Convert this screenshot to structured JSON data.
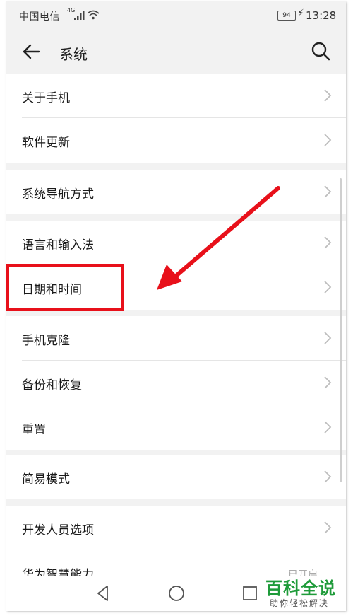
{
  "status_bar": {
    "carrier": "中国电信",
    "network": "4G",
    "battery": "94",
    "time": "13:28"
  },
  "header": {
    "title": "系统",
    "back_icon": "back-arrow-icon",
    "search_icon": "search-icon"
  },
  "groups": [
    {
      "items": [
        {
          "label": "关于手机"
        },
        {
          "label": "软件更新"
        }
      ]
    },
    {
      "items": [
        {
          "label": "系统导航方式"
        }
      ]
    },
    {
      "items": [
        {
          "label": "语言和输入法"
        },
        {
          "label": "日期和时间"
        }
      ]
    },
    {
      "items": [
        {
          "label": "手机克隆"
        },
        {
          "label": "备份和恢复"
        },
        {
          "label": "重置"
        }
      ]
    },
    {
      "items": [
        {
          "label": "简易模式"
        }
      ]
    },
    {
      "items": [
        {
          "label": "开发人员选项"
        },
        {
          "label": "华为智慧能力",
          "extra": "已开启"
        }
      ]
    }
  ],
  "annotation": {
    "highlight_color": "#e8101a",
    "target": "日期和时间"
  },
  "watermark": {
    "title": "百科全说",
    "subtitle": "助你轻松解决",
    "color": "#1f9b3a"
  },
  "navbar": {
    "back_icon": "triangle-back-icon",
    "home_icon": "circle-home-icon",
    "recent_icon": "square-recent-icon"
  }
}
